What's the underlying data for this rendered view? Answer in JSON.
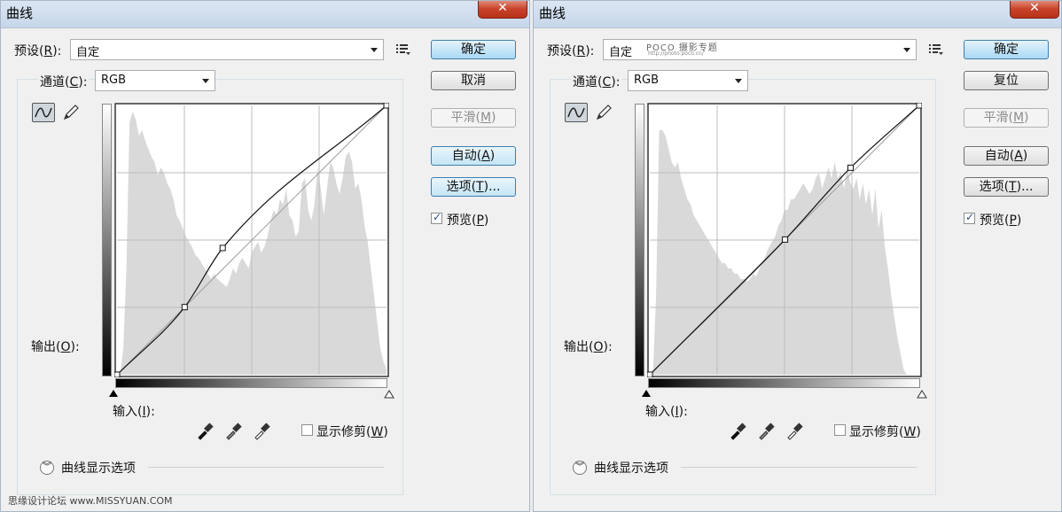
{
  "left": {
    "title": "曲线",
    "close_label": "✕",
    "preset_label": "预设(",
    "preset_key": "R",
    "preset_suffix": "):",
    "preset_value": "自定",
    "channel_label": "通道(",
    "channel_key": "C",
    "channel_suffix": "):",
    "channel_value": "RGB",
    "output_label": "输出(",
    "output_key": "O",
    "output_suffix": "):",
    "input_label": "输入(",
    "input_key": "I",
    "input_suffix": "):",
    "show_clipping_label": "显示修剪(",
    "show_clipping_key": "W",
    "show_clipping_suffix": ")",
    "curve_options_label": "曲线显示选项",
    "buttons": {
      "ok": "确定",
      "cancel": "取消",
      "smooth_text": "平滑(",
      "smooth_key": "M",
      "smooth_suffix": ")",
      "auto_text": "自动(",
      "auto_key": "A",
      "auto_suffix": ")",
      "options_text": "选项(",
      "options_key": "T",
      "options_suffix": ")..."
    },
    "preview_text": "预览(",
    "preview_key": "P",
    "preview_suffix": ")",
    "preview_checked": true,
    "footer": "思缘设计论坛 www.MISSYUAN.COM"
  },
  "right": {
    "title": "曲线",
    "close_label": "✕",
    "preset_label": "预设(",
    "preset_key": "R",
    "preset_suffix": "):",
    "preset_value": "自定",
    "watermark_logo": "POCO 摄影专题",
    "watermark_url": "http://photo.poco.cn/",
    "channel_label": "通道(",
    "channel_key": "C",
    "channel_suffix": "):",
    "channel_value": "RGB",
    "output_label": "输出(",
    "output_key": "O",
    "output_suffix": "):",
    "input_label": "输入(",
    "input_key": "I",
    "input_suffix": "):",
    "show_clipping_label": "显示修剪(",
    "show_clipping_key": "W",
    "show_clipping_suffix": ")",
    "curve_options_label": "曲线显示选项",
    "buttons": {
      "ok": "确定",
      "reset": "复位",
      "smooth_text": "平滑(",
      "smooth_key": "M",
      "smooth_suffix": ")",
      "auto_text": "自动(",
      "auto_key": "A",
      "auto_suffix": ")",
      "options_text": "选项(",
      "options_key": "T",
      "options_suffix": ")..."
    },
    "preview_text": "预览(",
    "preview_key": "P",
    "preview_suffix": ")",
    "preview_checked": true
  },
  "curves": {
    "left_points": [
      [
        0,
        0
      ],
      [
        64,
        64
      ],
      [
        100,
        120
      ],
      [
        255,
        255
      ]
    ],
    "right_points": [
      [
        0,
        0
      ],
      [
        128,
        128
      ],
      [
        190,
        196
      ],
      [
        255,
        255
      ]
    ],
    "left_histogram": [
      0,
      0,
      10,
      40,
      95,
      99,
      96,
      90,
      92,
      88,
      85,
      82,
      80,
      75,
      78,
      76,
      72,
      70,
      66,
      60,
      58,
      55,
      52,
      50,
      48,
      45,
      44,
      42,
      40,
      38,
      36,
      38,
      36,
      35,
      34,
      33,
      36,
      40,
      38,
      42,
      44,
      42,
      40,
      46,
      48,
      50,
      46,
      48,
      52,
      58,
      62,
      60,
      66,
      64,
      70,
      60,
      58,
      52,
      54,
      72,
      74,
      62,
      58,
      64,
      78,
      70,
      60,
      70,
      80,
      78,
      72,
      68,
      74,
      82,
      84,
      80,
      70,
      72,
      66,
      56,
      50,
      40,
      30,
      20,
      10,
      5,
      2
    ],
    "right_histogram": [
      0,
      0,
      30,
      92,
      92,
      90,
      85,
      80,
      78,
      80,
      74,
      70,
      66,
      64,
      60,
      58,
      56,
      54,
      52,
      50,
      48,
      46,
      44,
      42,
      42,
      40,
      40,
      38,
      38,
      36,
      36,
      35,
      36,
      38,
      37,
      40,
      42,
      45,
      48,
      50,
      52,
      56,
      58,
      62,
      62,
      66,
      66,
      68,
      70,
      72,
      70,
      68,
      70,
      74,
      76,
      70,
      74,
      78,
      74,
      80,
      74,
      76,
      70,
      78,
      72,
      70,
      74,
      66,
      72,
      64,
      70,
      60,
      70,
      55,
      62,
      48,
      40,
      30,
      22,
      14,
      8,
      2,
      0,
      0,
      0,
      0,
      0
    ]
  }
}
